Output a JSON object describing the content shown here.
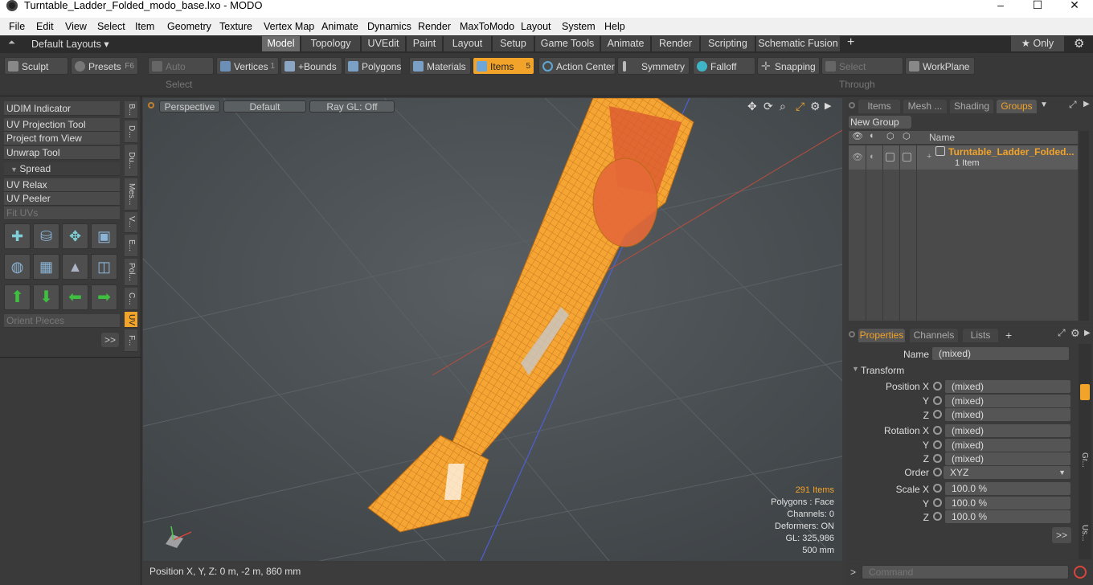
{
  "window": {
    "title": "Turntable_Ladder_Folded_modo_base.lxo - MODO",
    "minimize": "–",
    "maximize": "☐",
    "close": "✕"
  },
  "menu": [
    "File",
    "Edit",
    "View",
    "Select",
    "Item",
    "Geometry",
    "Texture",
    "Vertex Map",
    "Animate",
    "Dynamics",
    "Render",
    "MaxToModo",
    "Layout",
    "System",
    "Help"
  ],
  "layout_bar": {
    "layout_select": "Default Layouts ▾",
    "tabs": [
      "Model",
      "Topology",
      "UVEdit",
      "Paint",
      "Layout",
      "Setup",
      "Game Tools",
      "Animate",
      "Render",
      "Scripting",
      "Schematic Fusion"
    ],
    "active_tab": "Model",
    "add": "+",
    "only_label": "★  Only",
    "gear": "⚙"
  },
  "toolbar": {
    "sculpt": "Sculpt",
    "presets": "Presets",
    "presets_key": "F6",
    "auto_select": "Auto Select",
    "vertices": "Vertices",
    "vertices_count": "1",
    "bounds": "+Bounds",
    "polygons": "Polygons",
    "materials": "Materials",
    "items": "Items",
    "items_count": "5",
    "action_center": "Action Center",
    "symmetry": "Symmetry",
    "falloff": "Falloff",
    "snapping": "Snapping",
    "select_through": "Select Through",
    "workplane": "WorkPlane"
  },
  "left_panel": {
    "udim": "UDIM Indicator",
    "uv_projection": "UV Projection Tool",
    "project_from_view": "Project from View",
    "unwrap": "Unwrap Tool",
    "spread": "Spread",
    "uv_relax": "UV Relax",
    "uv_peeler": "UV Peeler",
    "fit_uvs": "Fit UVs",
    "orient_pieces": "Orient Pieces",
    "more": ">>",
    "side_tabs": [
      "B...",
      "D...",
      "Du...",
      "Mes...",
      "V...",
      "E...",
      "Pol...",
      "C...",
      "UV",
      "F..."
    ]
  },
  "viewport": {
    "view_mode": "Perspective",
    "shading": "Default",
    "raygl": "Ray GL: Off",
    "items_count": "291 Items",
    "polygons": "Polygons : Face",
    "channels": "Channels: 0",
    "deformers": "Deformers: ON",
    "gl": "GL: 325,986",
    "scale": "500 mm"
  },
  "status": {
    "position": "Position X, Y, Z:   0 m, -2 m, 860 mm"
  },
  "groups_panel": {
    "tabs": [
      "Items",
      "Mesh ...",
      "Shading",
      "Groups"
    ],
    "active": "Groups",
    "new_group": "New Group",
    "name_col": "Name",
    "item_name": "Turntable_Ladder_Folded...",
    "item_sub": "1 Item"
  },
  "properties": {
    "tabs": [
      "Properties",
      "Channels",
      "Lists"
    ],
    "active": "Properties",
    "add": "+",
    "name_label": "Name",
    "name_value": "(mixed)",
    "transform": "Transform",
    "position_x": "Position X",
    "rotation_x": "Rotation X",
    "y": "Y",
    "z": "Z",
    "mixed": "(mixed)",
    "order_label": "Order",
    "order_value": "XYZ",
    "scale_x": "Scale X",
    "scale_value": "100.0 %",
    "more": ">>",
    "side_tabs": [
      "Gr...",
      "Us..."
    ]
  },
  "command": {
    "placeholder": "Command",
    "prompt": ">"
  },
  "colors": {
    "accent": "#f2a32a",
    "viewport_bg": "#4a4f52",
    "panel_bg": "#3a3a3a"
  }
}
